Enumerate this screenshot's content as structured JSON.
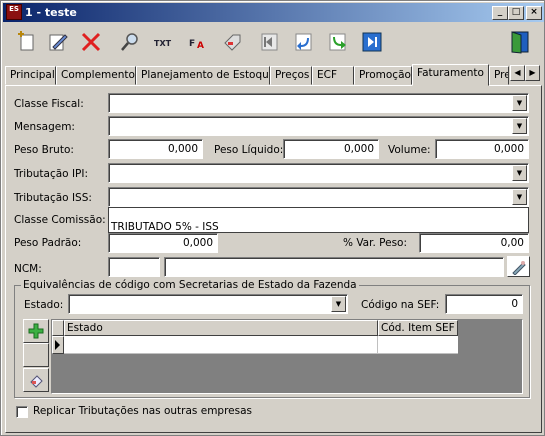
{
  "window": {
    "title": "1 - teste",
    "icon_label": "ES"
  },
  "tabs": [
    "Principal",
    "Complemento",
    "Planejamento de Estoque",
    "Preços",
    "ECF",
    "Promoção",
    "Faturamento",
    "Pre"
  ],
  "active_tab": "Faturamento",
  "form": {
    "classe_fiscal_label": "Classe Fiscal:",
    "classe_fiscal_value": "",
    "mensagem_label": "Mensagem:",
    "mensagem_value": "",
    "peso_bruto_label": "Peso Bruto:",
    "peso_bruto_value": "0,000",
    "peso_liquido_label": "Peso Líquido:",
    "peso_liquido_value": "0,000",
    "volume_label": "Volume:",
    "volume_value": "0,000",
    "tributacao_ipi_label": "Tributação IPI:",
    "tributacao_ipi_value": "",
    "tributacao_iss_label": "Tributação ISS:",
    "tributacao_iss_value": "",
    "classe_comissao_label": "Classe Comissão:",
    "classe_comissao_value": "TRIBUTADO 5% - ISS",
    "peso_padrao_label": "Peso Padrão:",
    "peso_padrao_value": "0,000",
    "var_peso_label": "% Var. Peso:",
    "var_peso_value": "0,00",
    "ncm_label": "NCM:",
    "ncm_code": "",
    "ncm_desc": ""
  },
  "equivalencias": {
    "title": "Equivalências de código com Secretarias de Estado da Fazenda",
    "estado_label": "Estado:",
    "estado_value": "",
    "codigo_sef_label": "Código na SEF:",
    "codigo_sef_value": "0",
    "columns": [
      "Estado",
      "Cód. Item SEF"
    ]
  },
  "replicar_label": "Replicar Tributações nas outras empresas",
  "replicar_checked": false,
  "toolbar_icons": [
    "new-icon",
    "edit-icon",
    "delete-icon",
    "search-icon",
    "txt-icon",
    "fa-icon",
    "tag-icon",
    "first-record-icon",
    "previous-record-icon",
    "next-record-icon",
    "last-record-icon",
    "exit-door-icon"
  ]
}
